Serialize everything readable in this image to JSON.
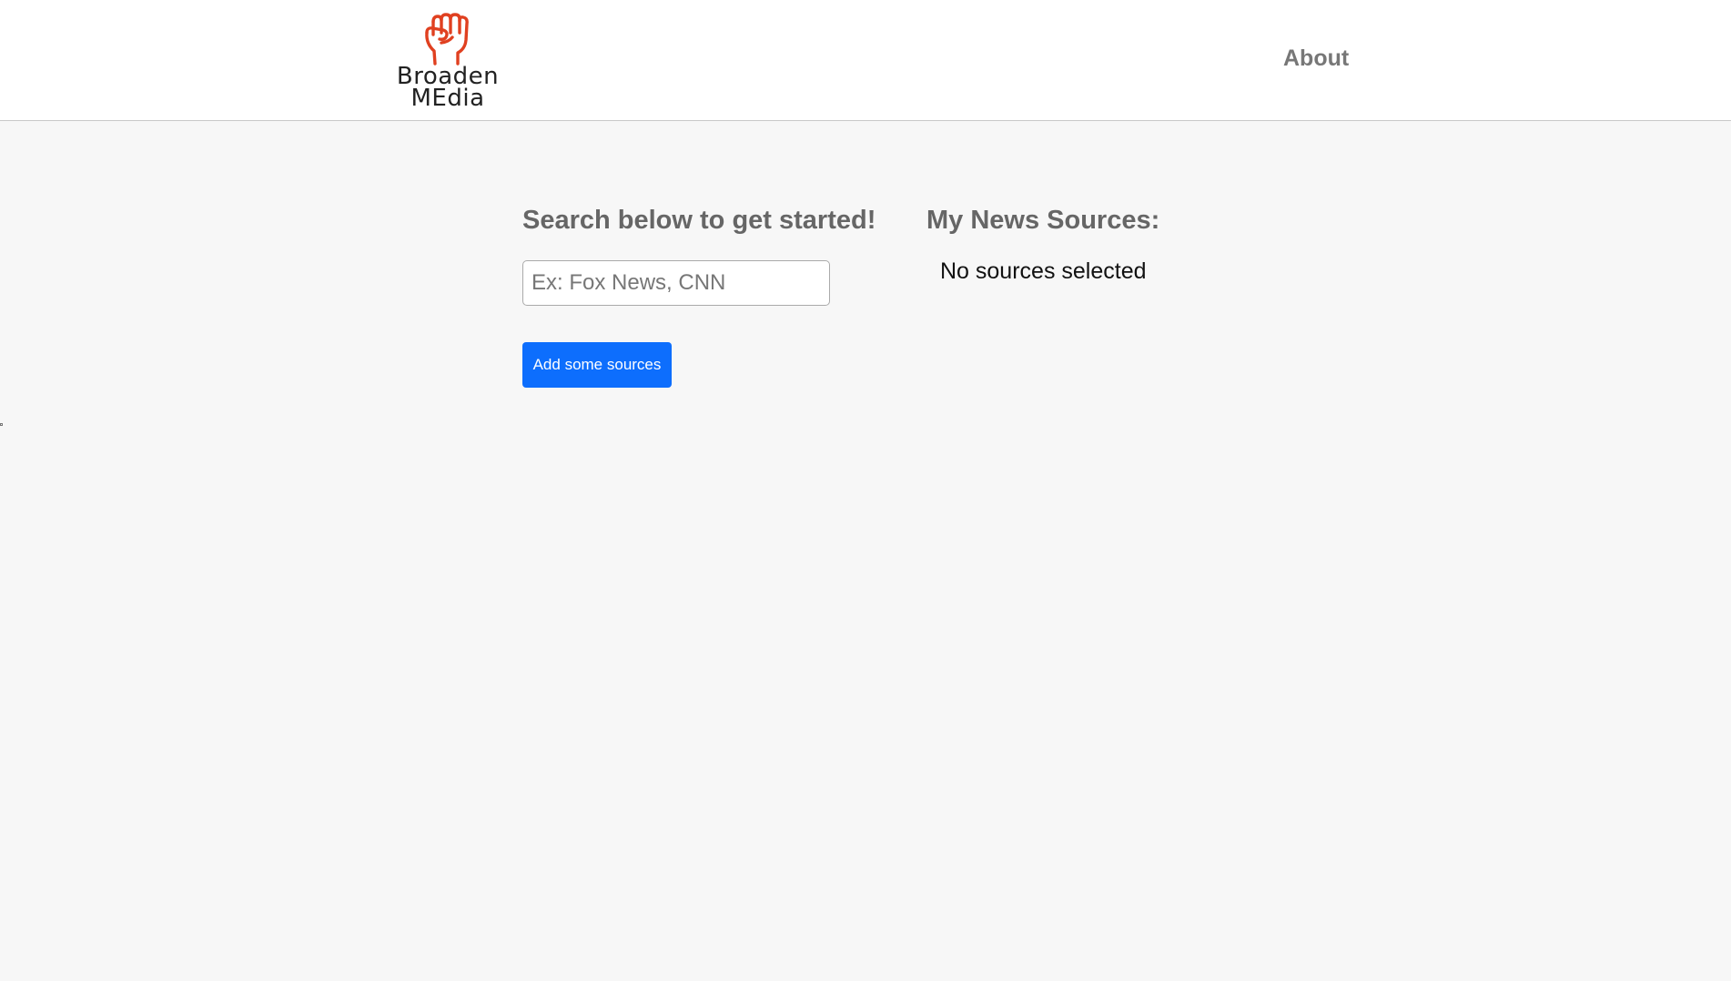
{
  "header": {
    "logo": {
      "icon": "raised-fist-icon",
      "line1": "Broaden",
      "line2": "MEdia",
      "icon_color": "#e04020"
    },
    "nav": {
      "about_label": "About"
    }
  },
  "search": {
    "heading": "Search below to get started!",
    "placeholder": "Ex: Fox News, CNN",
    "value": "",
    "button_label": "Add some sources",
    "button_color": "#0d6efd"
  },
  "sources": {
    "heading": "My News Sources:",
    "empty_text": "No sources selected"
  }
}
